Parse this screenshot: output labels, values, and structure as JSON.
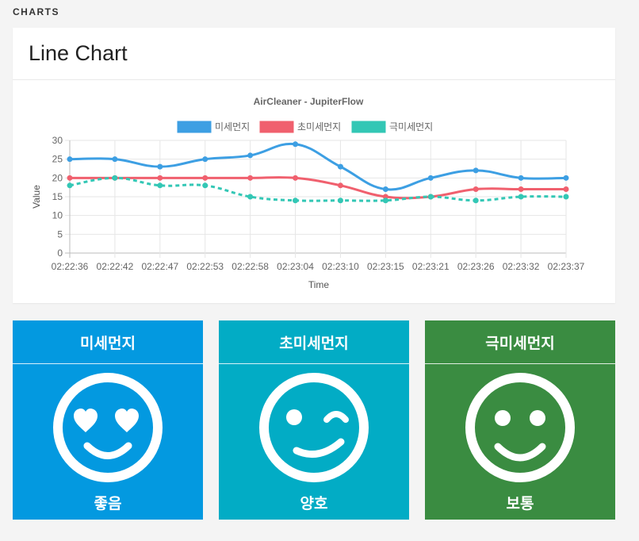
{
  "section": {
    "label": "CHARTS"
  },
  "card": {
    "title": "Line Chart"
  },
  "chart_data": {
    "type": "line",
    "title": "AirCleaner - JupiterFlow",
    "xlabel": "Time",
    "ylabel": "Value",
    "ylim": [
      0,
      30
    ],
    "yticks": [
      0,
      5,
      10,
      15,
      20,
      25,
      30
    ],
    "grid": true,
    "legend_position": "top",
    "categories": [
      "02:22:36",
      "02:22:42",
      "02:22:47",
      "02:22:53",
      "02:22:58",
      "02:23:04",
      "02:23:10",
      "02:23:15",
      "02:23:21",
      "02:23:26",
      "02:23:32",
      "02:23:37"
    ],
    "series": [
      {
        "name": "미세먼지",
        "color": "#3d9fe3",
        "dashed": false,
        "values": [
          25,
          25,
          23,
          25,
          26,
          29,
          23,
          17,
          20,
          22,
          20,
          20
        ]
      },
      {
        "name": "초미세먼지",
        "color": "#f0606e",
        "dashed": false,
        "values": [
          20,
          20,
          20,
          20,
          20,
          20,
          18,
          15,
          15,
          17,
          17,
          17
        ]
      },
      {
        "name": "극미세먼지",
        "color": "#33c7b5",
        "dashed": true,
        "values": [
          18,
          20,
          18,
          18,
          15,
          14,
          14,
          14,
          15,
          14,
          15,
          15
        ]
      }
    ]
  },
  "tiles": [
    {
      "title": "미세먼지",
      "status": "좋음",
      "face": "heart-eyes",
      "bg": "#0399e0"
    },
    {
      "title": "초미세먼지",
      "status": "양호",
      "face": "wink",
      "bg": "#02acc5"
    },
    {
      "title": "극미세먼지",
      "status": "보통",
      "face": "smile",
      "bg": "#3a8c41"
    }
  ]
}
